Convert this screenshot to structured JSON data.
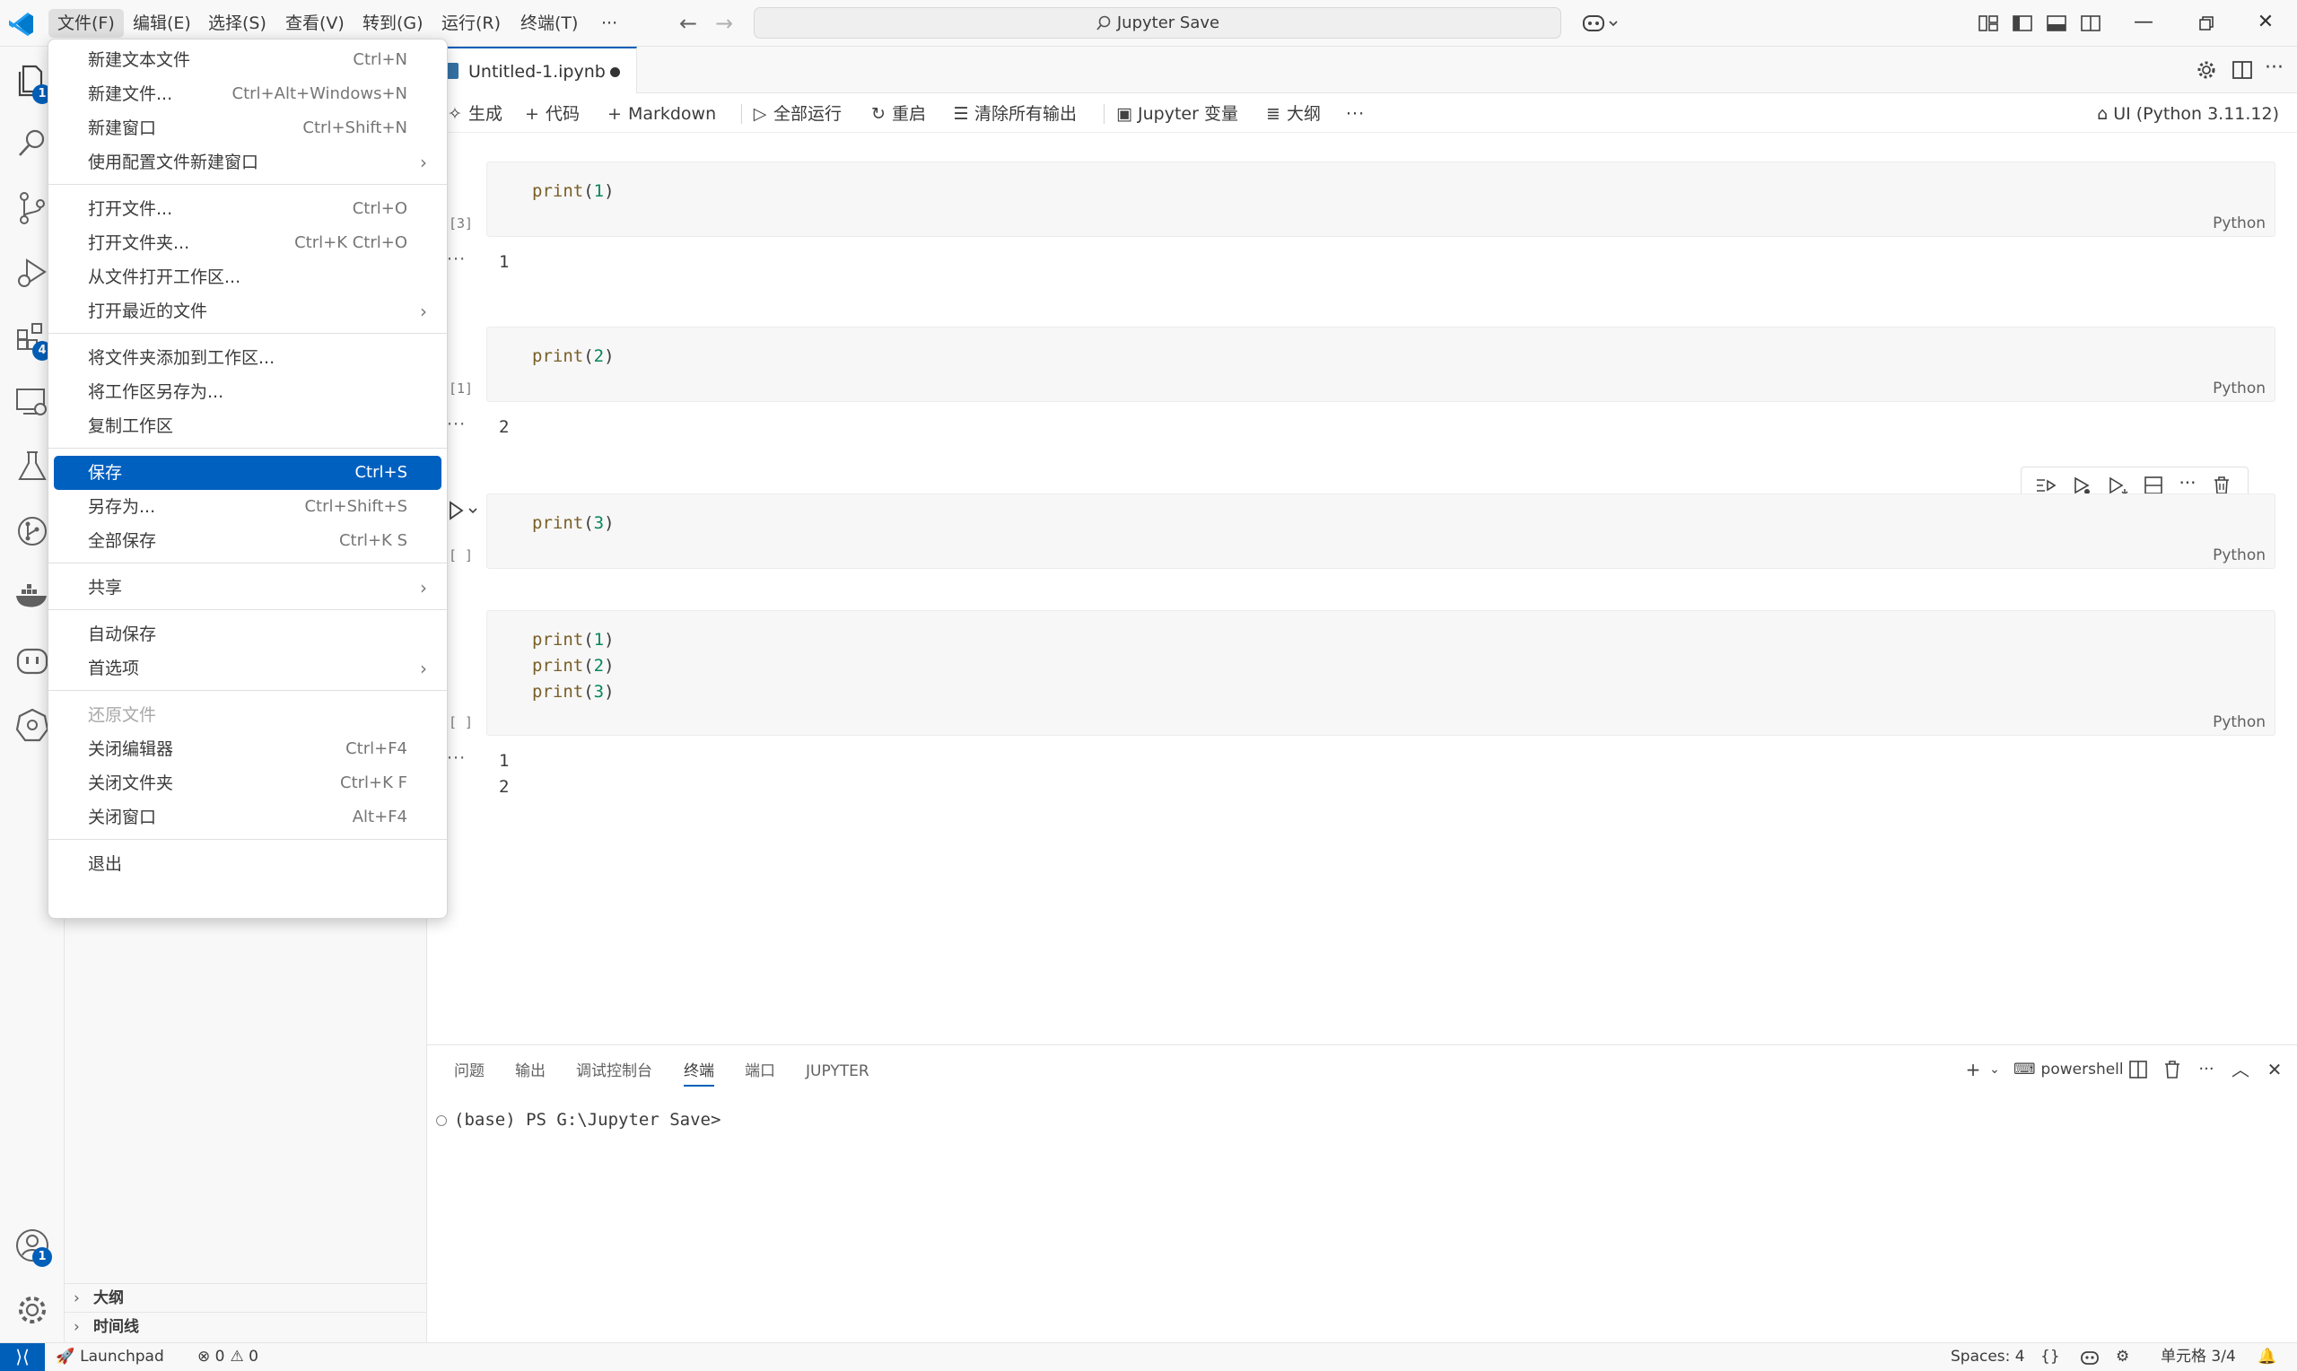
{
  "menubar": {
    "items": [
      "文件(F)",
      "编辑(E)",
      "选择(S)",
      "查看(V)",
      "转到(G)",
      "运行(R)",
      "终端(T)",
      "···"
    ]
  },
  "title": {
    "command_center": "Jupyter Save"
  },
  "activity_badges": {
    "explorer": "1",
    "extensions": "4",
    "accounts": "1"
  },
  "sidebar": {
    "sections": [
      "大纲",
      "时间线"
    ]
  },
  "editor": {
    "tab": {
      "title": "Untitled-1.ipynb"
    },
    "toolbar": {
      "generate": "生成",
      "code": "代码",
      "markdown": "Markdown",
      "run_all": "全部运行",
      "restart": "重启",
      "clear_outputs": "清除所有输出",
      "variables": "Jupyter 变量",
      "outline": "大纲",
      "more": "···",
      "kernel": "UI (Python 3.11.12)"
    },
    "cells": [
      {
        "exec_count": "[3]",
        "code": "print(1)",
        "language": "Python",
        "output": "1"
      },
      {
        "exec_count": "[1]",
        "code": "print(2)",
        "language": "Python",
        "output": "2"
      },
      {
        "exec_count": "[ ]",
        "code": "print(3)",
        "language": "Python",
        "output": ""
      },
      {
        "exec_count": "[ ]",
        "code": "print(1)\nprint(2)\nprint(3)",
        "language": "Python",
        "output": "1\n2"
      }
    ],
    "output_dots": "···"
  },
  "panel": {
    "tabs": [
      "问题",
      "输出",
      "调试控制台",
      "终端",
      "端口",
      "JUPYTER"
    ],
    "active_tab": "终端",
    "shell": "powershell",
    "terminal_line": "(base) PS G:\\Jupyter Save>"
  },
  "statusbar": {
    "launchpad": "Launchpad",
    "errors": "0",
    "warnings": "0",
    "spaces": "Spaces: 4",
    "braces": "{}",
    "cell_pos": "单元格 3/4"
  },
  "file_menu": {
    "items": [
      {
        "label": "新建文本文件",
        "shortcut": "Ctrl+N"
      },
      {
        "label": "新建文件...",
        "shortcut": "Ctrl+Alt+Windows+N"
      },
      {
        "label": "新建窗口",
        "shortcut": "Ctrl+Shift+N"
      },
      {
        "label": "使用配置文件新建窗口",
        "shortcut": ""
      },
      {
        "label": "打开文件...",
        "shortcut": "Ctrl+O"
      },
      {
        "label": "打开文件夹...",
        "shortcut": "Ctrl+K Ctrl+O"
      },
      {
        "label": "从文件打开工作区...",
        "shortcut": ""
      },
      {
        "label": "打开最近的文件",
        "shortcut": ""
      },
      {
        "label": "将文件夹添加到工作区...",
        "shortcut": ""
      },
      {
        "label": "将工作区另存为...",
        "shortcut": ""
      },
      {
        "label": "复制工作区",
        "shortcut": ""
      },
      {
        "label": "保存",
        "shortcut": "Ctrl+S"
      },
      {
        "label": "另存为...",
        "shortcut": "Ctrl+Shift+S"
      },
      {
        "label": "全部保存",
        "shortcut": "Ctrl+K S"
      },
      {
        "label": "共享",
        "shortcut": ""
      },
      {
        "label": "自动保存",
        "shortcut": ""
      },
      {
        "label": "首选项",
        "shortcut": ""
      },
      {
        "label": "还原文件",
        "shortcut": ""
      },
      {
        "label": "关闭编辑器",
        "shortcut": "Ctrl+F4"
      },
      {
        "label": "关闭文件夹",
        "shortcut": "Ctrl+K F"
      },
      {
        "label": "关闭窗口",
        "shortcut": "Alt+F4"
      },
      {
        "label": "退出",
        "shortcut": ""
      }
    ],
    "highlighted": "保存",
    "disabled": "还原文件"
  },
  "colors": {
    "accent": "#005fb8",
    "menu_highlight": "#0060c0"
  }
}
